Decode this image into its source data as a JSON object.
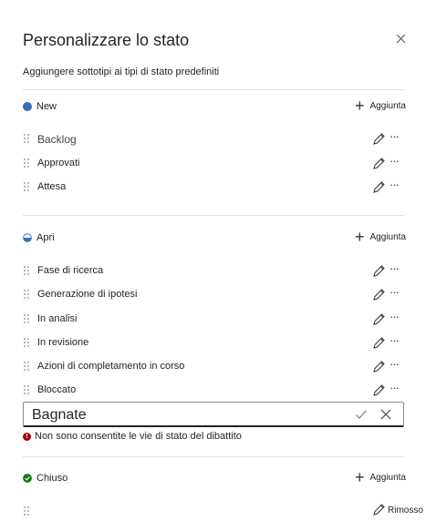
{
  "header": {
    "title": "Personalizzare lo stato",
    "subtitle": "Aggiungere sottotipi ai tipi di stato predefiniti"
  },
  "sections": {
    "new": {
      "name": "New",
      "color": "#3b6cb7",
      "add_label": "Aggiunta",
      "items": [
        {
          "label": "Backlog"
        },
        {
          "label": "Approvati"
        },
        {
          "label": "Attesa"
        }
      ]
    },
    "open": {
      "name": "Apri",
      "color": "#3b6cb7",
      "add_label": "Aggiunta",
      "items": [
        {
          "label": "Fase di ricerca"
        },
        {
          "label": "Generazione di ipotesi"
        },
        {
          "label": "In analisi"
        },
        {
          "label": "In revisione"
        },
        {
          "label": "Azioni di completamento in corso"
        },
        {
          "label": "Bloccato"
        }
      ]
    },
    "closed": {
      "name": "Chiuso",
      "color": "#107c10",
      "add_label": "Aggiunta",
      "remove_label": "Rimosso"
    }
  },
  "edit_field": {
    "value": "Bagnate",
    "error": "Non sono consentite le vie di stato del dibattito"
  },
  "icons": {
    "close": "close-icon",
    "add": "plus-icon",
    "edit": "pencil-icon",
    "more": "more-icon",
    "drag": "drag-handle-icon",
    "confirm": "checkmark-icon",
    "cancel": "cancel-icon",
    "error": "error-icon"
  },
  "colors": {
    "error": "#a80000",
    "accent": "#3b6cb7",
    "closed": "#107c10"
  }
}
